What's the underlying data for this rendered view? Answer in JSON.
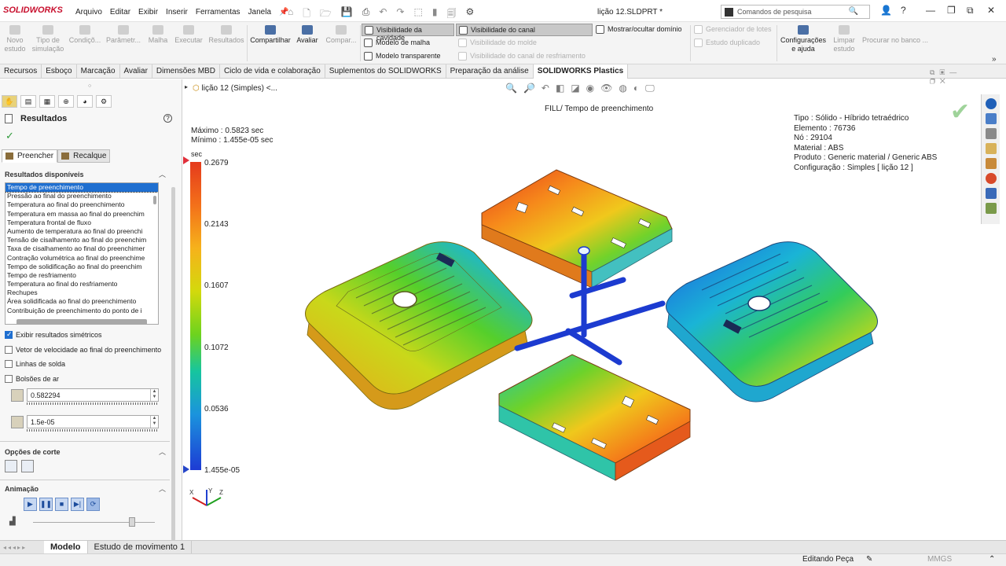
{
  "app": {
    "brand": "SOLIDWORKS",
    "doc_title": "lição 12.SLDPRT *"
  },
  "menu": [
    "Arquivo",
    "Editar",
    "Exibir",
    "Inserir",
    "Ferramentas",
    "Janela"
  ],
  "search": {
    "placeholder": "Comandos de pesquisa"
  },
  "toolbar": {
    "buttons": [
      {
        "label": "Novo\nestudo",
        "enabled": false
      },
      {
        "label": "Tipo de\nsimulação",
        "enabled": false
      },
      {
        "label": "Condiçõ...",
        "enabled": false
      },
      {
        "label": "Parâmetr...",
        "enabled": false
      },
      {
        "label": "Malha",
        "enabled": false
      },
      {
        "label": "Executar",
        "enabled": false
      },
      {
        "label": "Resultados",
        "enabled": false
      },
      {
        "label": "Compartilhar",
        "enabled": true
      },
      {
        "label": "Avaliar",
        "enabled": true
      },
      {
        "label": "Compar...",
        "enabled": false
      }
    ],
    "toggles": [
      {
        "label": "Visibilidade da cavidade",
        "pressed": true,
        "enabled": true
      },
      {
        "label": "Modelo de malha",
        "pressed": false,
        "enabled": true
      },
      {
        "label": "Modelo transparente",
        "pressed": false,
        "enabled": true
      },
      {
        "label": "Visibilidade do canal",
        "pressed": true,
        "enabled": true
      },
      {
        "label": "Visibilidade do molde",
        "pressed": false,
        "enabled": false
      },
      {
        "label": "Visibilidade do canal de resfriamento",
        "pressed": false,
        "enabled": false
      }
    ],
    "domain_toggle": "Mostrar/ocultar domínio",
    "right_group": [
      "Gerenciador de lotes",
      "Estudo duplicado"
    ],
    "config_help": "Configurações\ne ajuda",
    "clear_study": "Limpar\nestudo",
    "search_bank": "Procurar no banco ..."
  },
  "tabs": [
    "Recursos",
    "Esboço",
    "Marcação",
    "Avaliar",
    "Dimensões MBD",
    "Ciclo de vida e colaboração",
    "Suplementos do SOLIDWORKS",
    "Preparação da análise",
    "SOLIDWORKS Plastics"
  ],
  "active_tab": "SOLIDWORKS Plastics",
  "panel": {
    "title": "Resultados",
    "subtabs": [
      "Preencher",
      "Recalque"
    ],
    "available_header": "Resultados disponíveis",
    "results": [
      "Tempo de preenchimento",
      "Pressão ao final do preenchimento",
      "Temperatura ao final do preenchimento",
      "Temperatura em massa ao final do preenchim",
      "Temperatura frontal de fluxo",
      "Aumento de temperatura ao final do preenchi",
      "Tensão de cisalhamento ao final do preenchim",
      "Taxa de cisalhamento ao final do preenchimer",
      "Contração volumétrica ao final do preenchime",
      "Tempo de solidificação ao final do preenchim",
      "Tempo de resfriamento",
      "Temperatura ao final do resfriamento",
      "Rechupes",
      "Área solidificada ao final do preenchimento",
      "Contribuição de preenchimento do ponto de i"
    ],
    "selected_result": 0,
    "checkboxes": [
      {
        "label": "Exibir resultados simétricos",
        "checked": true
      },
      {
        "label": "Vetor de velocidade ao final do preenchimento",
        "checked": false
      },
      {
        "label": "Linhas de solda",
        "checked": false
      },
      {
        "label": "Bolsões de ar",
        "checked": false
      }
    ],
    "max_value": "0.582294",
    "min_value": "1.5e-05",
    "cut_options": "Opções de corte",
    "animation": "Animação",
    "anim_buttons": [
      "▶",
      "❚❚",
      "■",
      "▶|",
      "⟳"
    ],
    "anim_position": 0.8
  },
  "viewport": {
    "tree_label": "lição 12 (Simples) <...",
    "plot_title": "FILL/ Tempo de preenchimento",
    "maximo": "Máximo : 0.5823 sec",
    "minimo": "Mínimo : 1.455e-05 sec",
    "unit": "sec",
    "colorbar_ticks": [
      "0.2679",
      "0.2143",
      "0.1607",
      "0.1072",
      "0.0536",
      "1.455e-05"
    ],
    "info": [
      "Tipo : Sólido - Híbrido tetraédrico",
      "Elemento : 76736",
      "Nó : 29104",
      "Material : ABS",
      "Produto : Generic material / Generic ABS",
      "Configuração : Simples [ lição 12 ]"
    ],
    "part_label": "SOLIDWORKS"
  },
  "bottom_tabs": [
    "Modelo",
    "Estudo de movimento 1"
  ],
  "status": {
    "editing": "Editando Peça",
    "units": "MMGS"
  },
  "colors": {
    "accent": "#1f6fd0",
    "brand": "#c8102e"
  }
}
